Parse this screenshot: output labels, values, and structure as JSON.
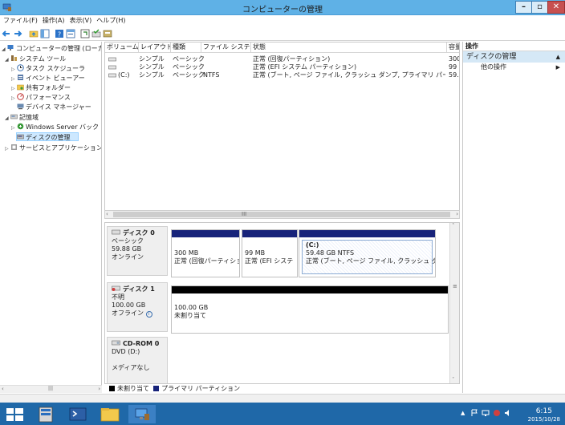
{
  "window": {
    "title": "コンピューターの管理"
  },
  "menu": [
    "ファイル(F)",
    "操作(A)",
    "表示(V)",
    "ヘルプ(H)"
  ],
  "tree": [
    {
      "label": "コンピューターの管理 (ローカル)",
      "level": 0,
      "expander": "◢"
    },
    {
      "label": "システム ツール",
      "level": 1,
      "expander": "◢"
    },
    {
      "label": "タスク スケジューラ",
      "level": 2,
      "expander": "▷"
    },
    {
      "label": "イベント ビューアー",
      "level": 2,
      "expander": "▷"
    },
    {
      "label": "共有フォルダー",
      "level": 2,
      "expander": "▷"
    },
    {
      "label": "パフォーマンス",
      "level": 2,
      "expander": "▷"
    },
    {
      "label": "デバイス マネージャー",
      "level": 2,
      "expander": ""
    },
    {
      "label": "記憶域",
      "level": 1,
      "expander": "◢"
    },
    {
      "label": "Windows Server バック",
      "level": 2,
      "expander": "▷"
    },
    {
      "label": "ディスクの管理",
      "level": 2,
      "expander": "",
      "selected": true
    },
    {
      "label": "サービスとアプリケーション",
      "level": 1,
      "expander": "▷"
    }
  ],
  "volume_list": {
    "headers": [
      "ボリューム",
      "レイアウト",
      "種類",
      "ファイル システム",
      "状態",
      "容量"
    ],
    "rows": [
      {
        "volume": "",
        "layout": "シンプル",
        "type": "ベーシック",
        "fs": "",
        "status": "正常 (回復パーティション)",
        "capacity": "300"
      },
      {
        "volume": "",
        "layout": "シンプル",
        "type": "ベーシック",
        "fs": "",
        "status": "正常 (EFI システム パーティション)",
        "capacity": "99"
      },
      {
        "volume": "(C:)",
        "layout": "シンプル",
        "type": "ベーシック",
        "fs": "NTFS",
        "status": "正常 (ブート, ページ ファイル, クラッシュ ダンプ, プライマリ パーティション)",
        "capacity": "59."
      }
    ],
    "scroll_grip": "III"
  },
  "disks": [
    {
      "name": "ディスク 0",
      "type": "ベーシック",
      "size": "59.88 GB",
      "state": "オンライン",
      "partitions": [
        {
          "title": "",
          "line1": "300 MB",
          "line2": "正常 (回復パーティショ"
        },
        {
          "title": "",
          "line1": "99 MB",
          "line2": "正常 (EFI システ"
        },
        {
          "title": "(C:)",
          "line1": "59.48 GB NTFS",
          "line2": "正常 (ブート, ページ ファイル, クラッシュ ダンプ, プ"
        }
      ]
    },
    {
      "name": "ディスク 1",
      "type": "不明",
      "size": "100.00 GB",
      "state": "オフライン",
      "partitions": [
        {
          "title": "",
          "line1": "100.00 GB",
          "line2": "未割り当て"
        }
      ]
    },
    {
      "name": "CD-ROM 0",
      "type": "DVD (D:)",
      "size": "",
      "state": "メディアなし",
      "partitions": []
    }
  ],
  "legend": [
    {
      "label": "未割り当て",
      "color": "#000000"
    },
    {
      "label": "プライマリ パーティション",
      "color": "#17237a"
    }
  ],
  "actions": {
    "header": "操作",
    "section": "ディスクの管理",
    "items": [
      "他の操作"
    ]
  },
  "clock": {
    "time": "6:15",
    "date": "2015/10/28"
  }
}
